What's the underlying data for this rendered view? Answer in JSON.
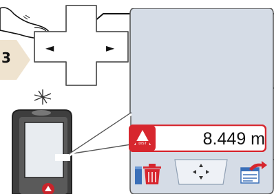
{
  "step": {
    "number": "3"
  },
  "dpad": {
    "left_arrow": "◄",
    "right_arrow": "►"
  },
  "display": {
    "measurement_value": "8.449 m",
    "mode_badge": "DIST",
    "mode_icon": "triangle-dist-icon"
  },
  "softkeys": {
    "left": "delete-icon",
    "center": "navigation-arrows-icon",
    "right": "export-data-icon"
  },
  "colors": {
    "accent_red": "#d7262e",
    "screen_bg": "#d6dde6",
    "blue_highlight": "#3a6fb8",
    "device_body": "#4a4a4a"
  }
}
